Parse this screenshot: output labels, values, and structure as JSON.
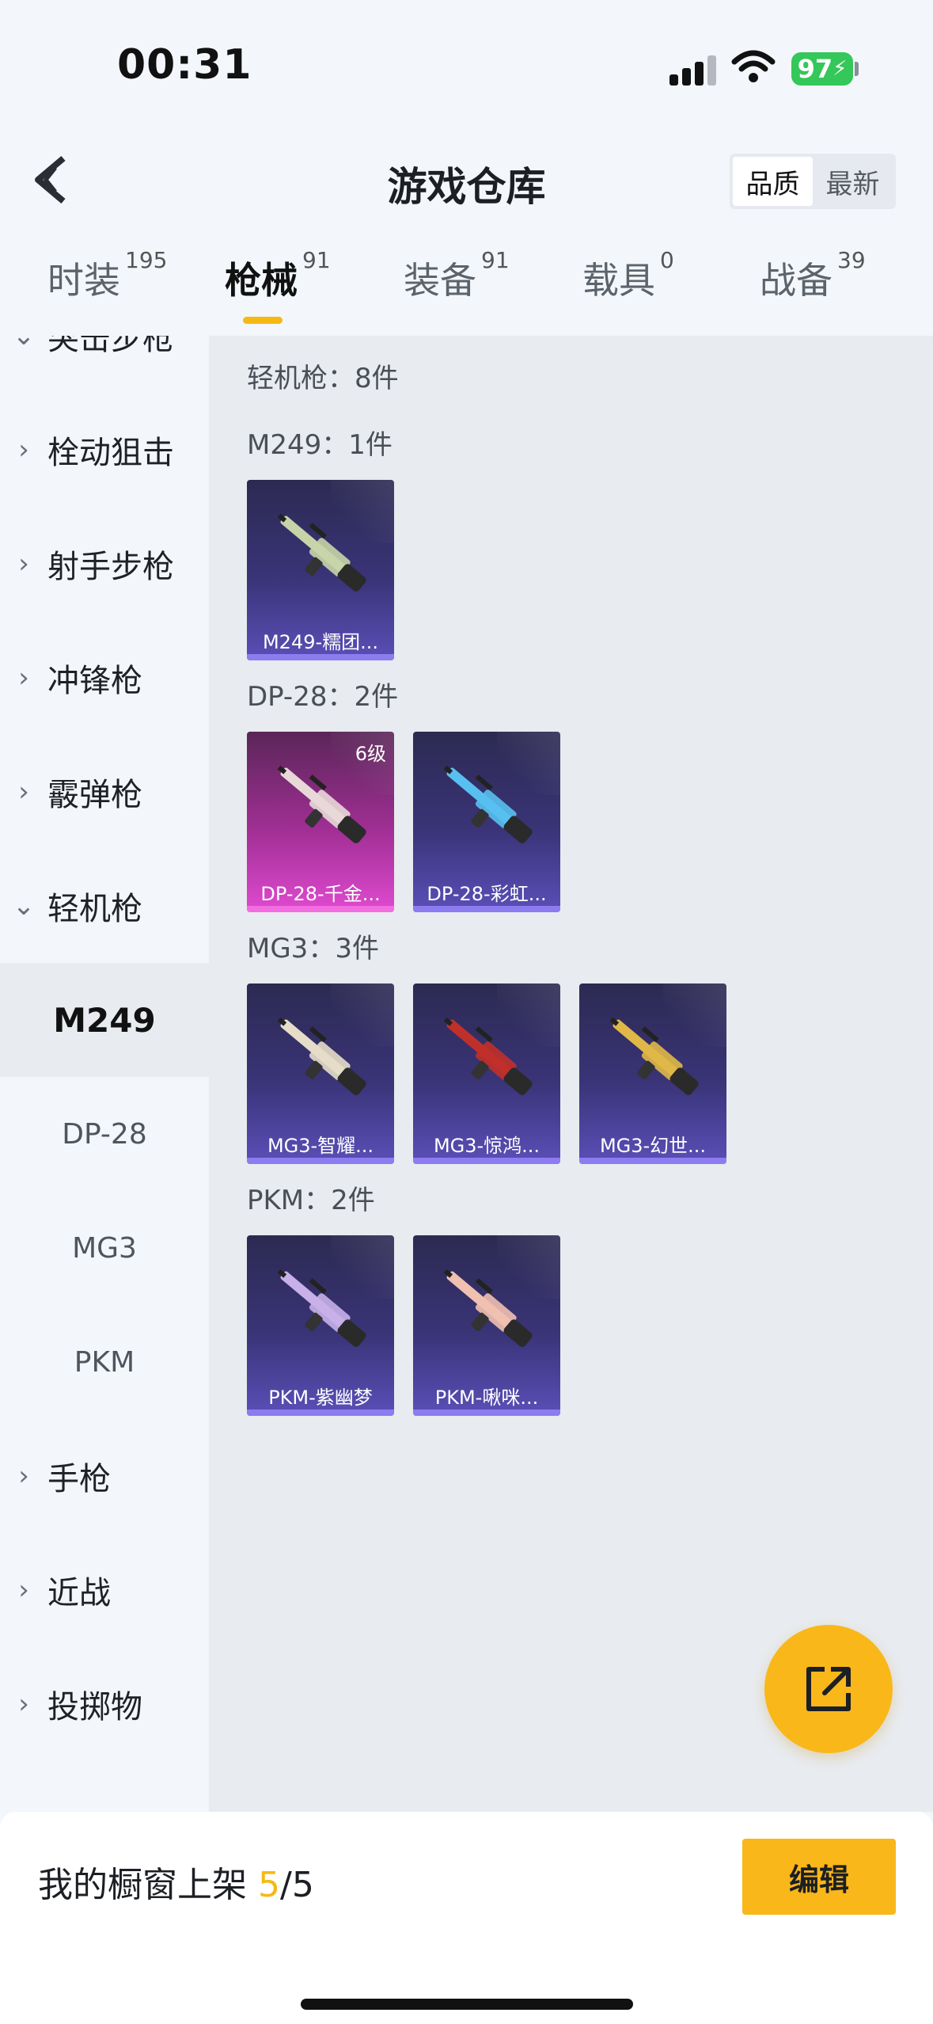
{
  "status_bar": {
    "time": "00:31",
    "battery": "97"
  },
  "header": {
    "title": "游戏仓库",
    "sort_options": [
      "品质",
      "最新"
    ],
    "active_sort": "品质"
  },
  "tabs": [
    {
      "label": "时装",
      "count": "195"
    },
    {
      "label": "枪械",
      "count": "91",
      "active": true
    },
    {
      "label": "装备",
      "count": "91"
    },
    {
      "label": "载具",
      "count": "0"
    },
    {
      "label": "战备",
      "count": "39"
    }
  ],
  "sidebar": {
    "partial_top": "突击步枪",
    "categories": [
      "栓动狙击",
      "射手步枪",
      "冲锋枪",
      "霰弹枪",
      "轻机枪"
    ],
    "sub_items": [
      "M249",
      "DP-28",
      "MG3",
      "PKM"
    ],
    "active_sub": "M249",
    "more_categories": [
      "手枪",
      "近战",
      "投掷物"
    ]
  },
  "main": {
    "section_summary": "轻机枪：8件",
    "groups": [
      {
        "label": "M249：1件",
        "items": [
          {
            "name": "M249-糯团...",
            "color": "#c8d4a8"
          }
        ]
      },
      {
        "label": "DP-28：2件",
        "items": [
          {
            "name": "DP-28-千金...",
            "level": "6级",
            "pink": true,
            "color": "#e8d8d8"
          },
          {
            "name": "DP-28-彩虹...",
            "color": "#58c0f0"
          }
        ]
      },
      {
        "label": "MG3：3件",
        "items": [
          {
            "name": "MG3-智耀...",
            "color": "#e6ddc8"
          },
          {
            "name": "MG3-惊鸿...",
            "color": "#c0302a"
          },
          {
            "name": "MG3-幻世...",
            "color": "#e0b848"
          }
        ]
      },
      {
        "label": "PKM：2件",
        "items": [
          {
            "name": "PKM-紫幽梦",
            "color": "#c8b0e8"
          },
          {
            "name": "PKM-啾咪...",
            "color": "#f0c0b0"
          }
        ]
      }
    ]
  },
  "bottom": {
    "showcase_prefix": "我的橱窗上架 ",
    "showcase_current": "5",
    "showcase_total": "/5",
    "edit_label": "编辑"
  },
  "colors": {
    "accent": "#f9b719",
    "card_bg": "#3a3478",
    "card_pink": "#a12f95"
  }
}
